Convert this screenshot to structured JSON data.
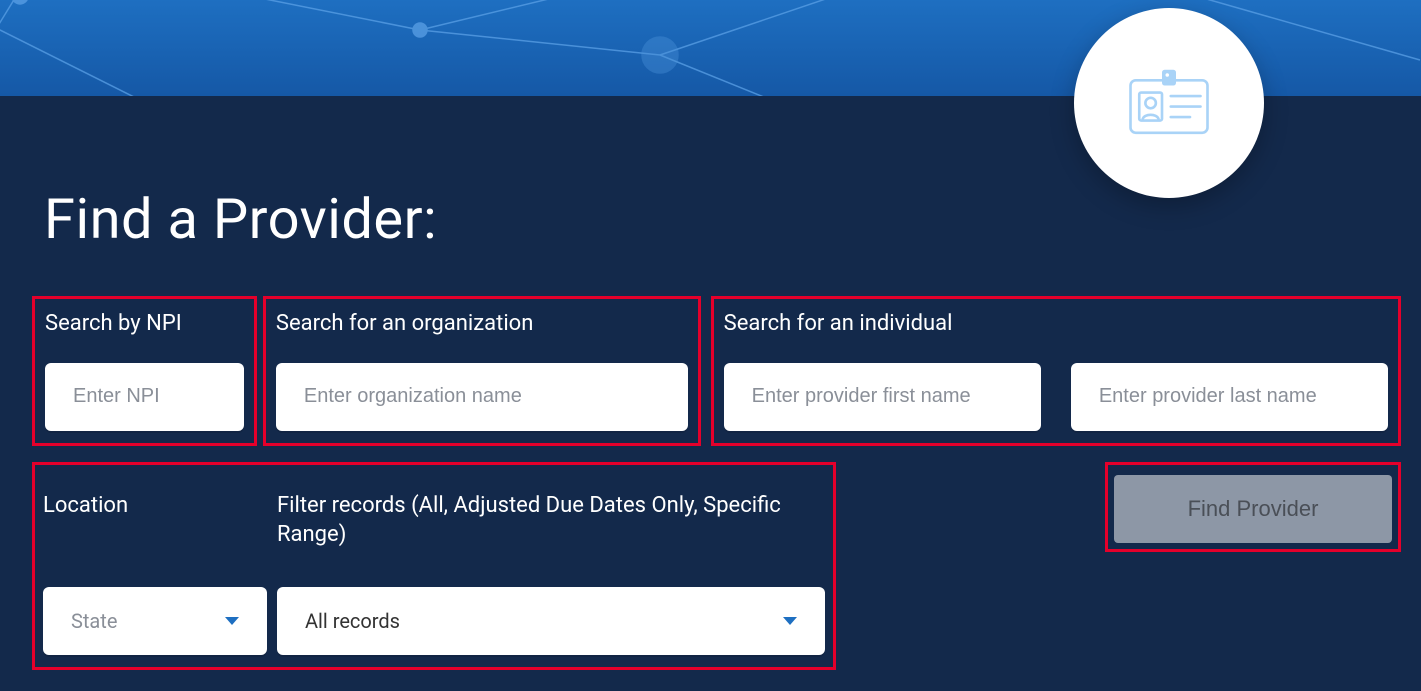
{
  "title": "Find a Provider:",
  "search_npi": {
    "label": "Search by NPI",
    "placeholder": "Enter NPI"
  },
  "search_org": {
    "label": "Search for an organization",
    "placeholder": "Enter organization name"
  },
  "search_individual": {
    "label": "Search for an individual",
    "first_placeholder": "Enter provider first name",
    "last_placeholder": "Enter provider last name"
  },
  "location": {
    "label": "Location",
    "selected": "State"
  },
  "filter": {
    "label": "Filter records (All, Adjusted Due Dates Only, Specific Range)",
    "selected": "All records"
  },
  "submit_label": "Find Provider",
  "colors": {
    "highlight": "#e4002b",
    "panel": "#13294b",
    "hero_top": "#1e6fc1",
    "hero_bot": "#1558a6",
    "button_bg": "#8d97a6"
  }
}
